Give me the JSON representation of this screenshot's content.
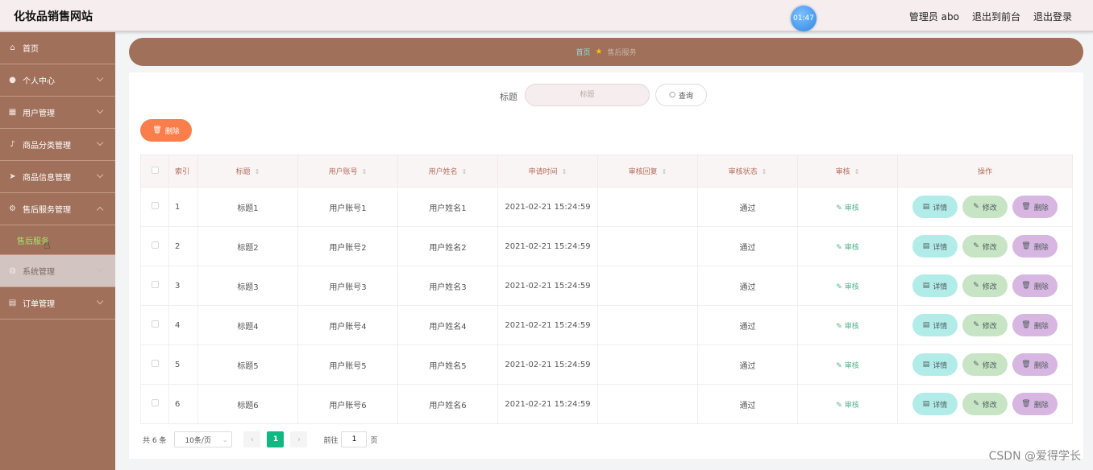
{
  "header": {
    "site_title": "化妆品销售网站",
    "clock": "01:47",
    "admin_label": "管理员 abo",
    "to_front": "退出到前台",
    "logout": "退出登录"
  },
  "sidebar": {
    "items": [
      {
        "label": "首页",
        "icon": "home-icon",
        "glyph": "⌂",
        "chevron": false
      },
      {
        "label": "个人中心",
        "icon": "user-icon",
        "glyph": "●",
        "chevron": true
      },
      {
        "label": "用户管理",
        "icon": "grid-icon",
        "glyph": "▦",
        "chevron": true
      },
      {
        "label": "商品分类管理",
        "icon": "mic-icon",
        "glyph": "♪",
        "chevron": true
      },
      {
        "label": "商品信息管理",
        "icon": "send-icon",
        "glyph": "➤",
        "chevron": true
      },
      {
        "label": "售后服务管理",
        "icon": "gear-icon",
        "glyph": "⚙",
        "chevron": true
      },
      {
        "label": "系统管理",
        "icon": "globe-icon",
        "glyph": "◍",
        "chevron": true
      },
      {
        "label": "订单管理",
        "icon": "table-icon",
        "glyph": "▤",
        "chevron": true
      }
    ],
    "submenu": "售后服务"
  },
  "breadcrumb": {
    "home": "首页",
    "current": "售后服务"
  },
  "search": {
    "label": "标题",
    "placeholder": "标题",
    "button": "查询"
  },
  "toolbar": {
    "delete_label": "删除"
  },
  "table": {
    "headers": {
      "index": "索引",
      "title": "标题",
      "account": "用户账号",
      "name": "用户姓名",
      "time": "申请时间",
      "reply": "审核回复",
      "status": "审核状态",
      "audit": "审核",
      "ops": "操作"
    },
    "rows": [
      {
        "index": "1",
        "title": "标题1",
        "account": "用户账号1",
        "name": "用户姓名1",
        "time": "2021-02-21 15:24:59",
        "reply": "",
        "status": "通过",
        "audit": "审核"
      },
      {
        "index": "2",
        "title": "标题2",
        "account": "用户账号2",
        "name": "用户姓名2",
        "time": "2021-02-21 15:24:59",
        "reply": "",
        "status": "通过",
        "audit": "审核"
      },
      {
        "index": "3",
        "title": "标题3",
        "account": "用户账号3",
        "name": "用户姓名3",
        "time": "2021-02-21 15:24:59",
        "reply": "",
        "status": "通过",
        "audit": "审核"
      },
      {
        "index": "4",
        "title": "标题4",
        "account": "用户账号4",
        "name": "用户姓名4",
        "time": "2021-02-21 15:24:59",
        "reply": "",
        "status": "通过",
        "audit": "审核"
      },
      {
        "index": "5",
        "title": "标题5",
        "account": "用户账号5",
        "name": "用户姓名5",
        "time": "2021-02-21 15:24:59",
        "reply": "",
        "status": "通过",
        "audit": "审核"
      },
      {
        "index": "6",
        "title": "标题6",
        "account": "用户账号6",
        "name": "用户姓名6",
        "time": "2021-02-21 15:24:59",
        "reply": "",
        "status": "通过",
        "audit": "审核"
      }
    ],
    "buttons": {
      "detail": "详情",
      "edit": "修改",
      "delete": "删除"
    }
  },
  "pagination": {
    "total": "共 6 条",
    "page_size": "10条/页",
    "current_page": "1",
    "goto_label": "前往",
    "goto_value": "1",
    "page_suffix": "页"
  },
  "watermark": "CSDN @爱得学长",
  "colors": {
    "sidebar": "#a0705a",
    "accent_green": "#10b981",
    "delete_orange": "#fa7e4b",
    "submenu_active": "#a6e36c"
  }
}
